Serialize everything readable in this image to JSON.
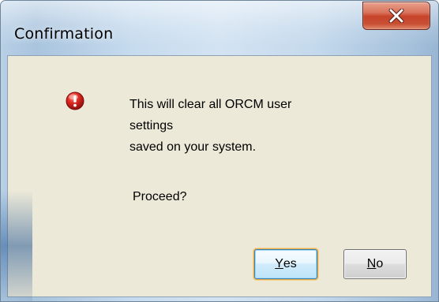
{
  "window": {
    "title": "Confirmation",
    "close_symbol": "x"
  },
  "dialog": {
    "icon": "error-icon",
    "message_lines": [
      "This will clear all ORCM user",
      "settings",
      "saved on your system."
    ],
    "prompt": "Proceed?"
  },
  "buttons": {
    "yes": {
      "mnemonic": "Y",
      "rest": "es",
      "default": true
    },
    "no": {
      "mnemonic": "N",
      "rest": "o",
      "default": false
    }
  },
  "colors": {
    "dialog_background": "#ece9d8",
    "close_button": "#c6442a",
    "error_icon": "#d21f1f",
    "default_button_focus": "#e9ad4d"
  }
}
